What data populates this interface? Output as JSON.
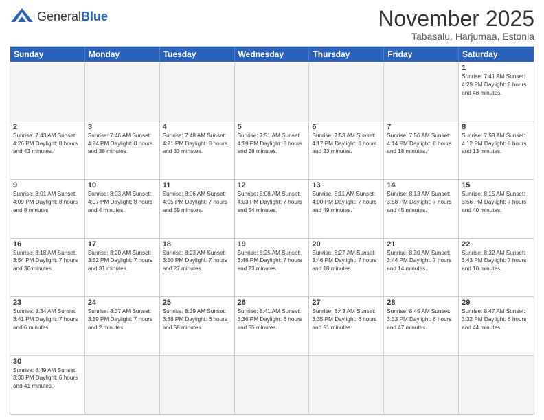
{
  "header": {
    "logo_general": "General",
    "logo_blue": "Blue",
    "month_title": "November 2025",
    "location": "Tabasalu, Harjumaa, Estonia"
  },
  "weekdays": [
    "Sunday",
    "Monday",
    "Tuesday",
    "Wednesday",
    "Thursday",
    "Friday",
    "Saturday"
  ],
  "rows": [
    [
      {
        "day": "",
        "info": ""
      },
      {
        "day": "",
        "info": ""
      },
      {
        "day": "",
        "info": ""
      },
      {
        "day": "",
        "info": ""
      },
      {
        "day": "",
        "info": ""
      },
      {
        "day": "",
        "info": ""
      },
      {
        "day": "1",
        "info": "Sunrise: 7:41 AM\nSunset: 4:29 PM\nDaylight: 8 hours\nand 48 minutes."
      }
    ],
    [
      {
        "day": "2",
        "info": "Sunrise: 7:43 AM\nSunset: 4:26 PM\nDaylight: 8 hours\nand 43 minutes."
      },
      {
        "day": "3",
        "info": "Sunrise: 7:46 AM\nSunset: 4:24 PM\nDaylight: 8 hours\nand 38 minutes."
      },
      {
        "day": "4",
        "info": "Sunrise: 7:48 AM\nSunset: 4:21 PM\nDaylight: 8 hours\nand 33 minutes."
      },
      {
        "day": "5",
        "info": "Sunrise: 7:51 AM\nSunset: 4:19 PM\nDaylight: 8 hours\nand 28 minutes."
      },
      {
        "day": "6",
        "info": "Sunrise: 7:53 AM\nSunset: 4:17 PM\nDaylight: 8 hours\nand 23 minutes."
      },
      {
        "day": "7",
        "info": "Sunrise: 7:56 AM\nSunset: 4:14 PM\nDaylight: 8 hours\nand 18 minutes."
      },
      {
        "day": "8",
        "info": "Sunrise: 7:58 AM\nSunset: 4:12 PM\nDaylight: 8 hours\nand 13 minutes."
      }
    ],
    [
      {
        "day": "9",
        "info": "Sunrise: 8:01 AM\nSunset: 4:09 PM\nDaylight: 8 hours\nand 8 minutes."
      },
      {
        "day": "10",
        "info": "Sunrise: 8:03 AM\nSunset: 4:07 PM\nDaylight: 8 hours\nand 4 minutes."
      },
      {
        "day": "11",
        "info": "Sunrise: 8:06 AM\nSunset: 4:05 PM\nDaylight: 7 hours\nand 59 minutes."
      },
      {
        "day": "12",
        "info": "Sunrise: 8:08 AM\nSunset: 4:03 PM\nDaylight: 7 hours\nand 54 minutes."
      },
      {
        "day": "13",
        "info": "Sunrise: 8:11 AM\nSunset: 4:00 PM\nDaylight: 7 hours\nand 49 minutes."
      },
      {
        "day": "14",
        "info": "Sunrise: 8:13 AM\nSunset: 3:58 PM\nDaylight: 7 hours\nand 45 minutes."
      },
      {
        "day": "15",
        "info": "Sunrise: 8:15 AM\nSunset: 3:56 PM\nDaylight: 7 hours\nand 40 minutes."
      }
    ],
    [
      {
        "day": "16",
        "info": "Sunrise: 8:18 AM\nSunset: 3:54 PM\nDaylight: 7 hours\nand 36 minutes."
      },
      {
        "day": "17",
        "info": "Sunrise: 8:20 AM\nSunset: 3:52 PM\nDaylight: 7 hours\nand 31 minutes."
      },
      {
        "day": "18",
        "info": "Sunrise: 8:23 AM\nSunset: 3:50 PM\nDaylight: 7 hours\nand 27 minutes."
      },
      {
        "day": "19",
        "info": "Sunrise: 8:25 AM\nSunset: 3:48 PM\nDaylight: 7 hours\nand 23 minutes."
      },
      {
        "day": "20",
        "info": "Sunrise: 8:27 AM\nSunset: 3:46 PM\nDaylight: 7 hours\nand 18 minutes."
      },
      {
        "day": "21",
        "info": "Sunrise: 8:30 AM\nSunset: 3:44 PM\nDaylight: 7 hours\nand 14 minutes."
      },
      {
        "day": "22",
        "info": "Sunrise: 8:32 AM\nSunset: 3:43 PM\nDaylight: 7 hours\nand 10 minutes."
      }
    ],
    [
      {
        "day": "23",
        "info": "Sunrise: 8:34 AM\nSunset: 3:41 PM\nDaylight: 7 hours\nand 6 minutes."
      },
      {
        "day": "24",
        "info": "Sunrise: 8:37 AM\nSunset: 3:39 PM\nDaylight: 7 hours\nand 2 minutes."
      },
      {
        "day": "25",
        "info": "Sunrise: 8:39 AM\nSunset: 3:38 PM\nDaylight: 6 hours\nand 58 minutes."
      },
      {
        "day": "26",
        "info": "Sunrise: 8:41 AM\nSunset: 3:36 PM\nDaylight: 6 hours\nand 55 minutes."
      },
      {
        "day": "27",
        "info": "Sunrise: 8:43 AM\nSunset: 3:35 PM\nDaylight: 6 hours\nand 51 minutes."
      },
      {
        "day": "28",
        "info": "Sunrise: 8:45 AM\nSunset: 3:33 PM\nDaylight: 6 hours\nand 47 minutes."
      },
      {
        "day": "29",
        "info": "Sunrise: 8:47 AM\nSunset: 3:32 PM\nDaylight: 6 hours\nand 44 minutes."
      }
    ],
    [
      {
        "day": "30",
        "info": "Sunrise: 8:49 AM\nSunset: 3:30 PM\nDaylight: 6 hours\nand 41 minutes."
      },
      {
        "day": "",
        "info": ""
      },
      {
        "day": "",
        "info": ""
      },
      {
        "day": "",
        "info": ""
      },
      {
        "day": "",
        "info": ""
      },
      {
        "day": "",
        "info": ""
      },
      {
        "day": "",
        "info": ""
      }
    ]
  ]
}
